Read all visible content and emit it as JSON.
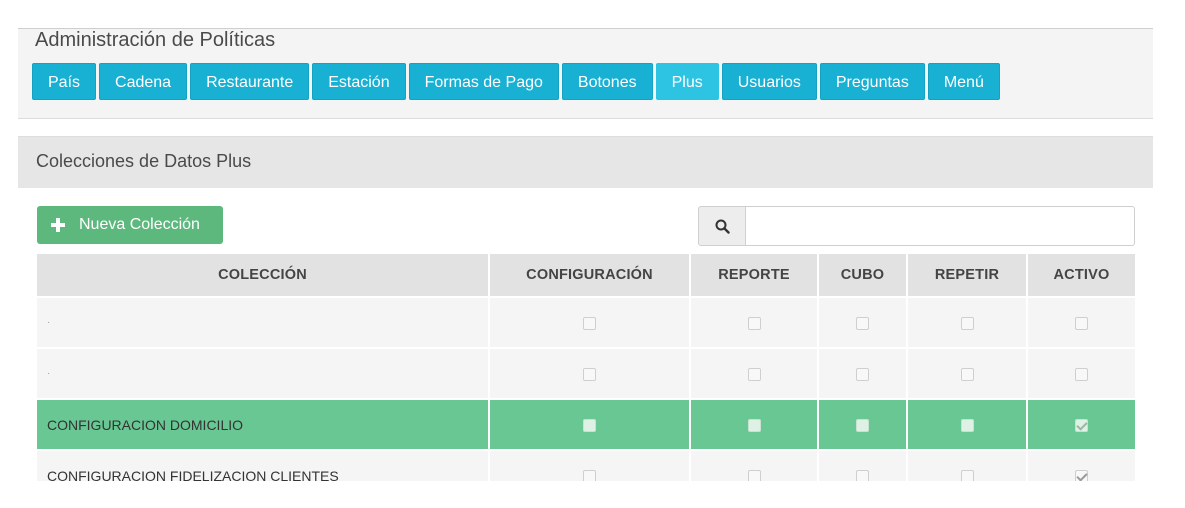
{
  "header": {
    "title": "Administración de Políticas"
  },
  "tabs": [
    {
      "label": "País"
    },
    {
      "label": "Cadena"
    },
    {
      "label": "Restaurante"
    },
    {
      "label": "Estación"
    },
    {
      "label": "Formas de Pago"
    },
    {
      "label": "Botones"
    },
    {
      "label": "Plus",
      "active": true
    },
    {
      "label": "Usuarios"
    },
    {
      "label": "Preguntas"
    },
    {
      "label": "Menú"
    }
  ],
  "panel": {
    "title": "Colecciones de Datos Plus"
  },
  "toolbar": {
    "new_label": "Nueva Colección",
    "search_icon": "search-icon",
    "search_value": ""
  },
  "table": {
    "columns": [
      "COLECCIÓN",
      "CONFIGURACIÓN",
      "REPORTE",
      "CUBO",
      "REPETIR",
      "ACTIVO"
    ],
    "rows": [
      {
        "name": "·",
        "configuracion": false,
        "reporte": false,
        "cubo": false,
        "repetir": false,
        "activo": false
      },
      {
        "name": "·",
        "configuracion": false,
        "reporte": false,
        "cubo": false,
        "repetir": false,
        "activo": false
      },
      {
        "name": "CONFIGURACION DOMICILIO",
        "selected": true,
        "configuracion": false,
        "reporte": false,
        "cubo": false,
        "repetir": false,
        "activo": true
      },
      {
        "name": "CONFIGURACION FIDELIZACION CLIENTES",
        "configuracion": false,
        "reporte": false,
        "cubo": false,
        "repetir": false,
        "activo": true
      }
    ]
  },
  "colors": {
    "tab": "#18b0d3",
    "tab_active": "#2dc3e3",
    "button_green": "#5cb87c",
    "row_selected": "#68c792"
  }
}
